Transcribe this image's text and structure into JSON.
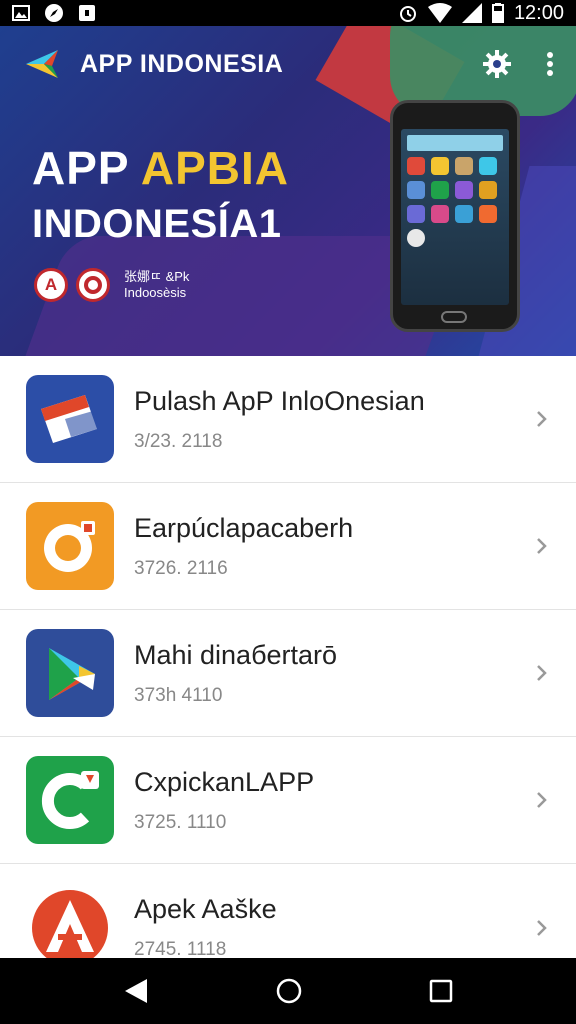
{
  "status_bar": {
    "time": "12:00"
  },
  "app_bar": {
    "title": "APP INDONESIA"
  },
  "hero": {
    "line1_part1": "APP",
    "line1_part2": "APBIA",
    "line2": "INDONESÍA1",
    "badge_a": "A",
    "badge_text_line1": "张娜ㄸ &Pk",
    "badge_text_line2": "Indoosèsis"
  },
  "apps": [
    {
      "name": "Pulash ApP InloOnesian",
      "meta": "3/23. 2118",
      "icon": "pulsa-ticket-icon",
      "color": "#2c4ea7"
    },
    {
      "name": "Earpúclapacaberh",
      "meta": "3726. 2116",
      "icon": "orange-camera-icon",
      "color": "#f29a24"
    },
    {
      "name": "Mahi dinaбertarō",
      "meta": "373h 4110",
      "icon": "play-triangle-icon",
      "color": "#2f4d9a"
    },
    {
      "name": "CxpickanLAPP",
      "meta": "3725. 1110",
      "icon": "green-c-icon",
      "color": "#1fa24a"
    },
    {
      "name": "Apek Aaške",
      "meta": "2745. 1118",
      "icon": "red-a-icon",
      "color": "#e0472a"
    }
  ],
  "colors": {
    "accent_yellow": "#f3c531",
    "header_blue": "#2b2c7a"
  }
}
